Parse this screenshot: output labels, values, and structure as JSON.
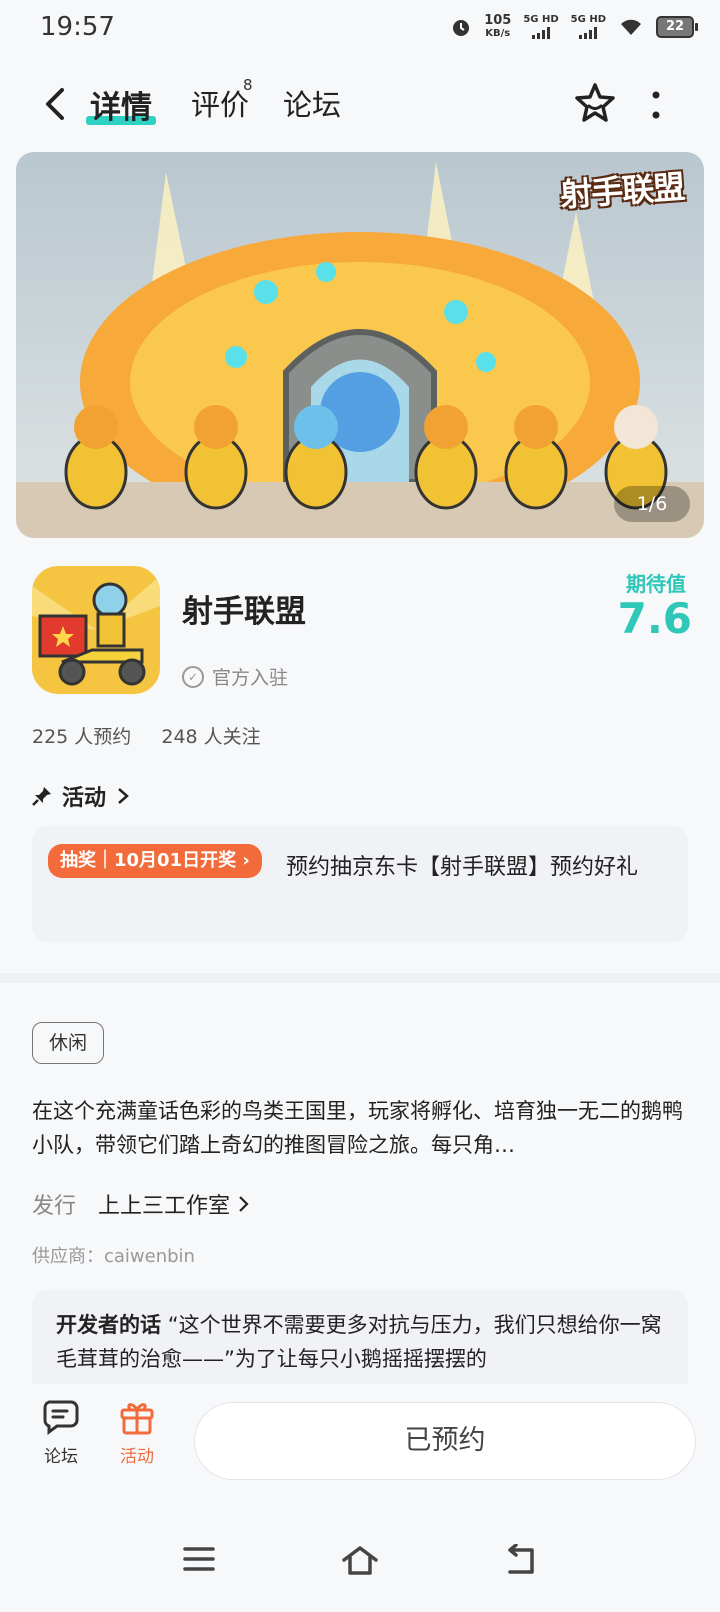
{
  "status": {
    "time": "19:57",
    "net_speed_value": "105",
    "net_speed_unit": "KB/s",
    "sim1": "5G HD",
    "sim2": "5G HD",
    "battery": "22"
  },
  "nav": {
    "tabs": [
      {
        "label": "详情"
      },
      {
        "label": "评价",
        "badge": "8"
      },
      {
        "label": "论坛"
      }
    ]
  },
  "banner": {
    "logo_text": "射手联盟",
    "counter": "1/6"
  },
  "app": {
    "name": "射手联盟",
    "official_label": "官方入驻",
    "expect_label": "期待值",
    "expect_score": "7.6",
    "reservations": "225 人预约",
    "followers": "248 人关注"
  },
  "activity": {
    "heading": "活动",
    "tag": "抽奖｜10月01日开奖",
    "text": "预约抽京东卡【射手联盟】预约好礼"
  },
  "details": {
    "genre_tag": "休闲",
    "description": "在这个充满童话色彩的鸟类王国里，玩家将孵化、培育独一无二的鹅鸭小队，带领它们踏上奇幻的推图冒险之旅。每只角…",
    "publisher_label": "发行",
    "publisher_name": "上上三工作室",
    "supplier": "供应商：caiwenbin",
    "dev_label": "开发者的话",
    "dev_text": "“这个世界不需要更多对抗与压力，我们只想给你一窝毛茸茸的治愈——”为了让每只小鹅摇摇摆摆的"
  },
  "bottom_bar": {
    "forum_label": "论坛",
    "activity_label": "活动",
    "reserve_label": "已预约"
  },
  "colors": {
    "accent_teal": "#2ec7b8",
    "accent_orange": "#f36b3b"
  }
}
